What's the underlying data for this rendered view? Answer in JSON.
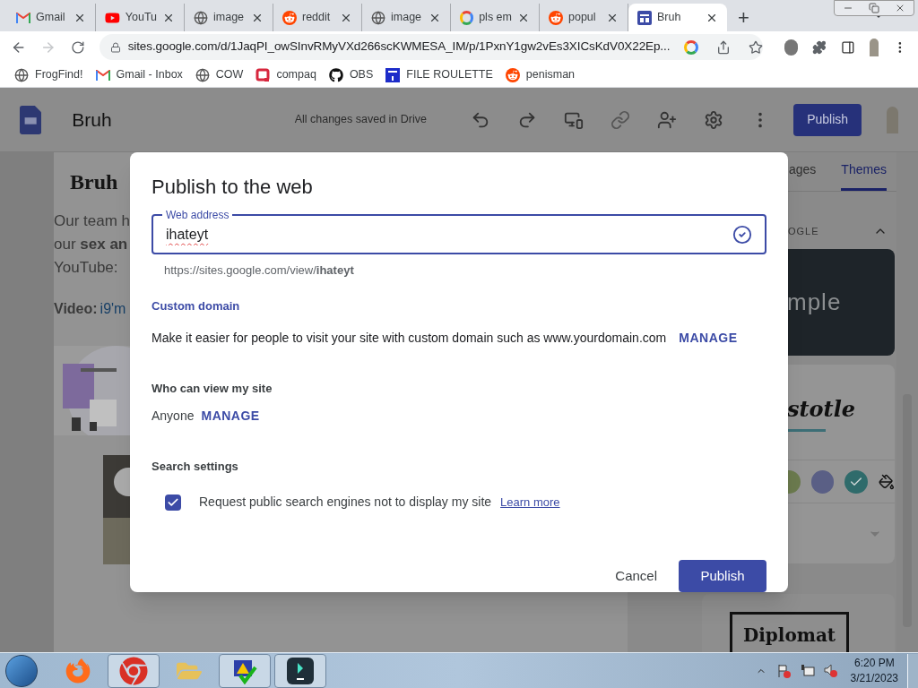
{
  "browser": {
    "tabs": [
      {
        "title": "Gmail",
        "kind": "gmail",
        "selected": false
      },
      {
        "title": "YouTu",
        "kind": "youtube",
        "selected": false
      },
      {
        "title": "image",
        "kind": "globe",
        "selected": false
      },
      {
        "title": "reddit",
        "kind": "reddit",
        "selected": false
      },
      {
        "title": "image",
        "kind": "globe",
        "selected": false
      },
      {
        "title": "pls em",
        "kind": "google",
        "selected": false
      },
      {
        "title": "popul",
        "kind": "reddit",
        "selected": false
      },
      {
        "title": "Bruh",
        "kind": "sites",
        "selected": true
      }
    ],
    "new_tab": "+",
    "toolbar": {
      "forward_disabled": true,
      "url": "sites.google.com/d/1JaqPI_owSInvRMyVXd266scKWMESA_IM/p/1PxnY1gw2vEs3XICsKdV0X22Ep..."
    },
    "bookmarks": [
      {
        "label": "FrogFind!",
        "kind": "globe"
      },
      {
        "label": "Gmail - Inbox",
        "kind": "gmail"
      },
      {
        "label": "COW",
        "kind": "globe"
      },
      {
        "label": "compaq",
        "kind": "compaq"
      },
      {
        "label": "OBS",
        "kind": "github"
      },
      {
        "label": "FILE ROULETTE",
        "kind": "mft"
      },
      {
        "label": "penisman",
        "kind": "reddit"
      }
    ]
  },
  "editor": {
    "site_name": "Bruh",
    "save_status": "All changes saved in Drive",
    "publish_button": "Publish",
    "page": {
      "site_title": "Bruh",
      "lines": [
        "Our team h",
        "our **sex an**",
        "YouTube:"
      ],
      "video_label": "Video:",
      "video_link": "i9'm"
    },
    "panel": {
      "tabs": [
        {
          "label": "ages",
          "selected": false
        },
        {
          "label": "Themes",
          "selected": true
        }
      ],
      "section": "OGLE",
      "section_expanded": true,
      "themes": [
        {
          "kind": "dark",
          "name": "mple"
        },
        {
          "kind": "serif",
          "name": "stotle",
          "swatches": [
            {
              "color": "#6b7a4e",
              "selected": false
            },
            {
              "color": "#5a5f85",
              "selected": false
            },
            {
              "color": "#2f6b6b",
              "selected": true
            }
          ]
        },
        {
          "kind": "boxed",
          "name": "Diplomat"
        }
      ]
    }
  },
  "dialog": {
    "title": "Publish to the web",
    "web_address": {
      "label": "Web address",
      "value": "ihateyt",
      "valid": true
    },
    "url_preview": "https://sites.google.com/view/**ihateyt**",
    "custom_domain": {
      "heading": "Custom domain",
      "text": "Make it easier for people to visit your site with custom domain such as www.yourdomain.com",
      "action": "MANAGE"
    },
    "viewers": {
      "heading": "Who can view my site",
      "value": "Anyone",
      "action": "MANAGE"
    },
    "search": {
      "heading": "Search settings",
      "option": "Request public search engines not to display my site",
      "checked": true,
      "link": "Learn more"
    },
    "buttons": [
      {
        "label": "Cancel",
        "kind": "text"
      },
      {
        "label": "Publish",
        "kind": "filled"
      }
    ]
  },
  "taskbar": {
    "apps": [
      {
        "kind": "firefox",
        "active": false
      },
      {
        "kind": "chrome",
        "active": true
      },
      {
        "kind": "explorer",
        "active": false
      },
      {
        "kind": "checker",
        "active": true
      },
      {
        "kind": "editor",
        "active": true
      }
    ],
    "time": "6:20 PM",
    "date": "3/21/2023"
  }
}
